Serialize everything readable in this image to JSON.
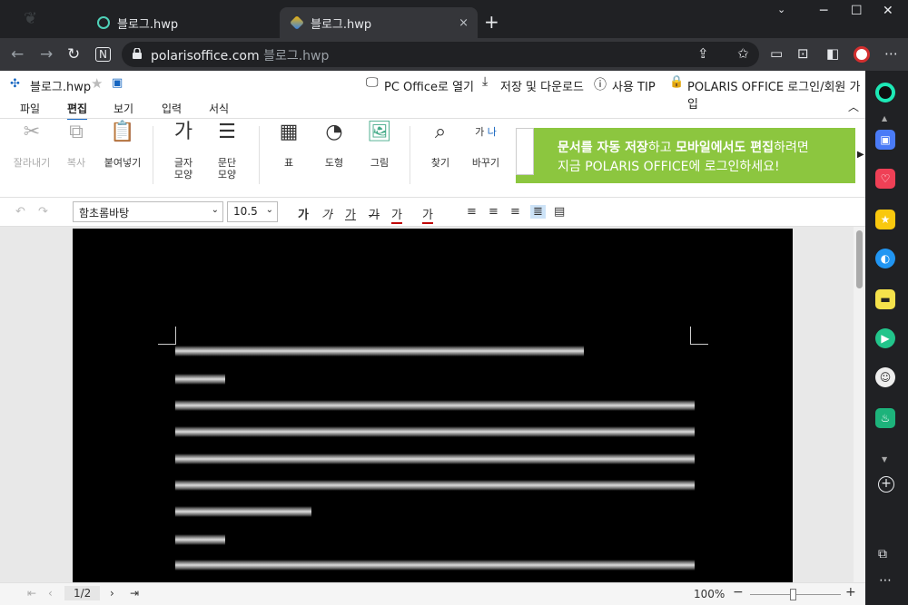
{
  "browser": {
    "tabs": [
      {
        "title": "블로그.hwp"
      },
      {
        "title": "블로그.hwp"
      }
    ],
    "new_tab": "+",
    "close": "×",
    "url_domain": "polarisoffice.com",
    "url_path": "블로그.hwp",
    "min": "─",
    "max": "☐",
    "win_close": "✕"
  },
  "header": {
    "doc_title": "블로그.hwp",
    "pc_office": "PC Office로 열기",
    "save_download": "저장 및 다운로드",
    "tip": "사용 TIP",
    "login": "POLARIS OFFICE 로그인/회원 가입"
  },
  "menu": {
    "items": [
      "파일",
      "편집",
      "보기",
      "입력",
      "서식"
    ],
    "active": "편집"
  },
  "ribbon": {
    "cut": "잘라내기",
    "copy": "복사",
    "paste": "붙여넣기",
    "char_1": "글자",
    "char_2": "모양",
    "para_1": "문단",
    "para_2": "모양",
    "char_glyph": "가",
    "table": "표",
    "shape": "도형",
    "image": "그림",
    "find": "찾기",
    "replace": "바꾸기",
    "replace_glyph_1": "가",
    "replace_glyph_2": "나",
    "banner_line1_bold1": "문서를 자동 저장",
    "banner_line1_normal1": "하고 ",
    "banner_line1_bold2": "모바일에서도 편집",
    "banner_line1_normal2": "하려면",
    "banner_line2": "지금 POLARIS OFFICE에 로그인하세요!"
  },
  "format": {
    "font": "함초롬바탕",
    "size": "10.5",
    "bold": "가",
    "italic": "가",
    "underline": "가",
    "strike": "가",
    "color": "가",
    "highlight": "가"
  },
  "status": {
    "page": "1/2",
    "zoom": "100%"
  },
  "colors": {
    "accent": "#1565c0",
    "banner": "#8cc63f",
    "zoom_red": "#c00000"
  }
}
